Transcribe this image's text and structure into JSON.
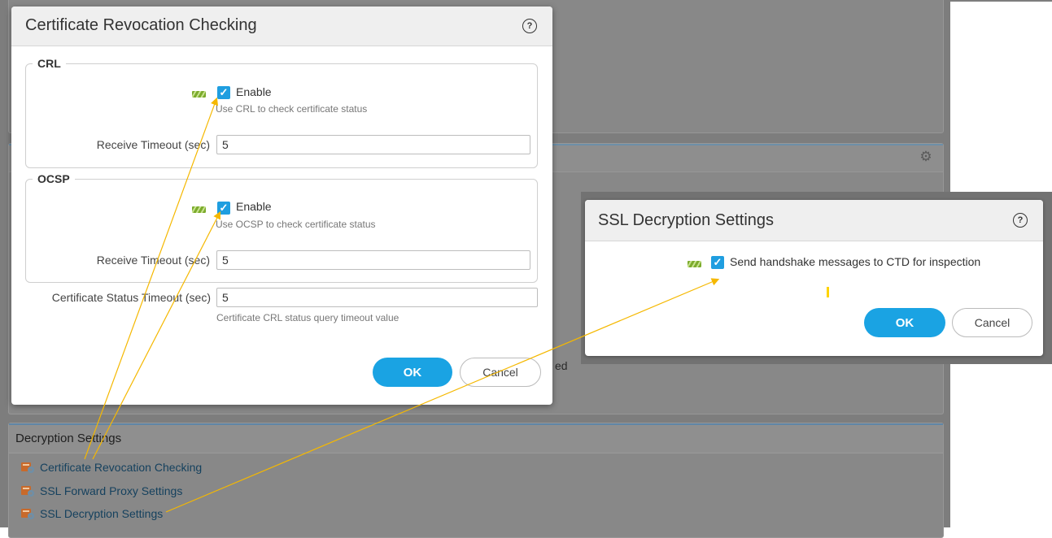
{
  "background": {
    "fragment_text": "ed",
    "decryption_panel": {
      "header": "Decryption Settings",
      "links": [
        {
          "label": "Certificate Revocation Checking",
          "icon": "certificate-settings-icon"
        },
        {
          "label": "SSL Forward Proxy Settings",
          "icon": "certificate-settings-icon"
        },
        {
          "label": "SSL Decryption Settings",
          "icon": "certificate-settings-icon"
        }
      ]
    },
    "panel_icon": "gear-icon"
  },
  "crc_dialog": {
    "title": "Certificate Revocation Checking",
    "help_icon": "help-icon",
    "crl": {
      "legend": "CRL",
      "enable_label": "Enable",
      "enable_checked": true,
      "enable_help": "Use CRL to check certificate status",
      "timeout_label": "Receive Timeout (sec)",
      "timeout_value": "5"
    },
    "ocsp": {
      "legend": "OCSP",
      "enable_label": "Enable",
      "enable_checked": true,
      "enable_help": "Use OCSP to check certificate status",
      "timeout_label": "Receive Timeout (sec)",
      "timeout_value": "5"
    },
    "status_timeout": {
      "label": "Certificate Status Timeout (sec)",
      "value": "5",
      "help": "Certificate CRL status query timeout value"
    },
    "ok_label": "OK",
    "cancel_label": "Cancel"
  },
  "ssl_dialog": {
    "title": "SSL Decryption Settings",
    "help_icon": "help-icon",
    "option_label": "Send handshake messages to CTD for inspection",
    "option_checked": true,
    "ok_label": "OK",
    "cancel_label": "Cancel"
  },
  "colors": {
    "accent": "#1aa3e3",
    "checkbox": "#1f9ee0",
    "annotation_arrow": "#f5b800",
    "link": "#15415e"
  }
}
